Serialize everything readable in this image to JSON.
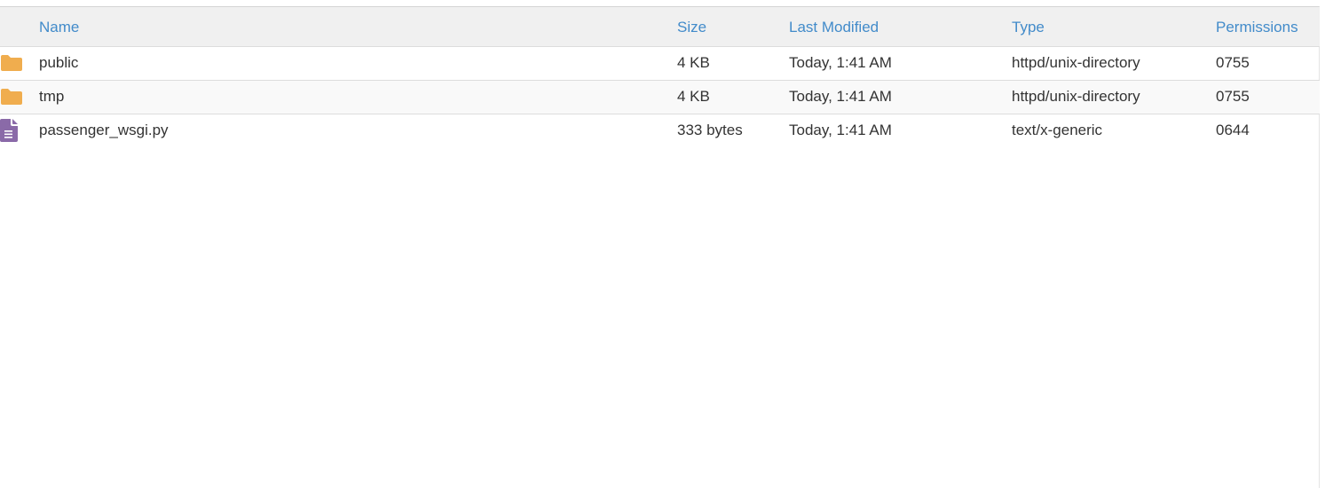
{
  "columns": {
    "name": "Name",
    "size": "Size",
    "modified": "Last Modified",
    "type": "Type",
    "permissions": "Permissions"
  },
  "colors": {
    "header_link": "#428bca",
    "folder": "#f0ad4e",
    "file": "#8a6aa8"
  },
  "files": [
    {
      "icon": "folder-icon",
      "name": "public",
      "size": "4 KB",
      "modified": "Today, 1:41 AM",
      "type": "httpd/unix-directory",
      "permissions": "0755"
    },
    {
      "icon": "folder-icon",
      "name": "tmp",
      "size": "4 KB",
      "modified": "Today, 1:41 AM",
      "type": "httpd/unix-directory",
      "permissions": "0755"
    },
    {
      "icon": "file-text-icon",
      "name": "passenger_wsgi.py",
      "size": "333 bytes",
      "modified": "Today, 1:41 AM",
      "type": "text/x-generic",
      "permissions": "0644"
    }
  ]
}
